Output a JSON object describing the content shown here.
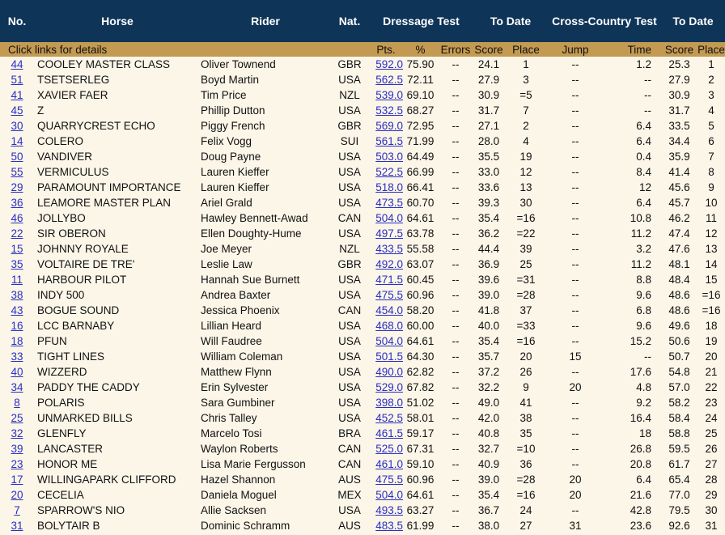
{
  "header": {
    "no": "No.",
    "horse": "Horse",
    "rider": "Rider",
    "nat": "Nat.",
    "dressage": "Dressage Test",
    "to_date_1": "To Date",
    "cross_country": "Cross-Country Test",
    "to_date_2": "To Date"
  },
  "subheader": {
    "hint": "Click links for details",
    "pts": "Pts.",
    "pct": "%",
    "errors": "Errors",
    "score": "Score",
    "place": "Place",
    "jump": "Jump",
    "time": "Time",
    "score2": "Score",
    "place2": "Place"
  },
  "rows": [
    {
      "no": "44",
      "horse": "COOLEY MASTER CLASS",
      "rider": "Oliver Townend",
      "nat": "GBR",
      "pts": "592.0",
      "pct": "75.90",
      "errors": "--",
      "score": "24.1",
      "place": "1",
      "jump": "--",
      "time": "1.2",
      "score2": "25.3",
      "place2": "1"
    },
    {
      "no": "51",
      "horse": "TSETSERLEG",
      "rider": "Boyd Martin",
      "nat": "USA",
      "pts": "562.5",
      "pct": "72.11",
      "errors": "--",
      "score": "27.9",
      "place": "3",
      "jump": "--",
      "time": "--",
      "score2": "27.9",
      "place2": "2"
    },
    {
      "no": "41",
      "horse": "XAVIER FAER",
      "rider": "Tim Price",
      "nat": "NZL",
      "pts": "539.0",
      "pct": "69.10",
      "errors": "--",
      "score": "30.9",
      "place": "=5",
      "jump": "--",
      "time": "--",
      "score2": "30.9",
      "place2": "3"
    },
    {
      "no": "45",
      "horse": "Z",
      "rider": "Phillip Dutton",
      "nat": "USA",
      "pts": "532.5",
      "pct": "68.27",
      "errors": "--",
      "score": "31.7",
      "place": "7",
      "jump": "--",
      "time": "--",
      "score2": "31.7",
      "place2": "4"
    },
    {
      "no": "30",
      "horse": "QUARRYCREST ECHO",
      "rider": "Piggy French",
      "nat": "GBR",
      "pts": "569.0",
      "pct": "72.95",
      "errors": "--",
      "score": "27.1",
      "place": "2",
      "jump": "--",
      "time": "6.4",
      "score2": "33.5",
      "place2": "5"
    },
    {
      "no": "14",
      "horse": "COLERO",
      "rider": "Felix Vogg",
      "nat": "SUI",
      "pts": "561.5",
      "pct": "71.99",
      "errors": "--",
      "score": "28.0",
      "place": "4",
      "jump": "--",
      "time": "6.4",
      "score2": "34.4",
      "place2": "6"
    },
    {
      "no": "50",
      "horse": "VANDIVER",
      "rider": "Doug Payne",
      "nat": "USA",
      "pts": "503.0",
      "pct": "64.49",
      "errors": "--",
      "score": "35.5",
      "place": "19",
      "jump": "--",
      "time": "0.4",
      "score2": "35.9",
      "place2": "7"
    },
    {
      "no": "55",
      "horse": "VERMICULUS",
      "rider": "Lauren Kieffer",
      "nat": "USA",
      "pts": "522.5",
      "pct": "66.99",
      "errors": "--",
      "score": "33.0",
      "place": "12",
      "jump": "--",
      "time": "8.4",
      "score2": "41.4",
      "place2": "8"
    },
    {
      "no": "29",
      "horse": "PARAMOUNT IMPORTANCE",
      "rider": "Lauren Kieffer",
      "nat": "USA",
      "pts": "518.0",
      "pct": "66.41",
      "errors": "--",
      "score": "33.6",
      "place": "13",
      "jump": "--",
      "time": "12",
      "score2": "45.6",
      "place2": "9"
    },
    {
      "no": "36",
      "horse": "LEAMORE MASTER PLAN",
      "rider": "Ariel Grald",
      "nat": "USA",
      "pts": "473.5",
      "pct": "60.70",
      "errors": "--",
      "score": "39.3",
      "place": "30",
      "jump": "--",
      "time": "6.4",
      "score2": "45.7",
      "place2": "10"
    },
    {
      "no": "46",
      "horse": "JOLLYBO",
      "rider": "Hawley Bennett-Awad",
      "nat": "CAN",
      "pts": "504.0",
      "pct": "64.61",
      "errors": "--",
      "score": "35.4",
      "place": "=16",
      "jump": "--",
      "time": "10.8",
      "score2": "46.2",
      "place2": "11"
    },
    {
      "no": "22",
      "horse": "SIR OBERON",
      "rider": "Ellen Doughty-Hume",
      "nat": "USA",
      "pts": "497.5",
      "pct": "63.78",
      "errors": "--",
      "score": "36.2",
      "place": "=22",
      "jump": "--",
      "time": "11.2",
      "score2": "47.4",
      "place2": "12"
    },
    {
      "no": "15",
      "horse": "JOHNNY ROYALE",
      "rider": "Joe Meyer",
      "nat": "NZL",
      "pts": "433.5",
      "pct": "55.58",
      "errors": "--",
      "score": "44.4",
      "place": "39",
      "jump": "--",
      "time": "3.2",
      "score2": "47.6",
      "place2": "13"
    },
    {
      "no": "35",
      "horse": "VOLTAIRE DE TRE'",
      "rider": "Leslie Law",
      "nat": "GBR",
      "pts": "492.0",
      "pct": "63.07",
      "errors": "--",
      "score": "36.9",
      "place": "25",
      "jump": "--",
      "time": "11.2",
      "score2": "48.1",
      "place2": "14"
    },
    {
      "no": "11",
      "horse": "HARBOUR PILOT",
      "rider": "Hannah Sue Burnett",
      "nat": "USA",
      "pts": "471.5",
      "pct": "60.45",
      "errors": "--",
      "score": "39.6",
      "place": "=31",
      "jump": "--",
      "time": "8.8",
      "score2": "48.4",
      "place2": "15"
    },
    {
      "no": "38",
      "horse": "INDY 500",
      "rider": "Andrea Baxter",
      "nat": "USA",
      "pts": "475.5",
      "pct": "60.96",
      "errors": "--",
      "score": "39.0",
      "place": "=28",
      "jump": "--",
      "time": "9.6",
      "score2": "48.6",
      "place2": "=16"
    },
    {
      "no": "43",
      "horse": "BOGUE SOUND",
      "rider": "Jessica Phoenix",
      "nat": "CAN",
      "pts": "454.0",
      "pct": "58.20",
      "errors": "--",
      "score": "41.8",
      "place": "37",
      "jump": "--",
      "time": "6.8",
      "score2": "48.6",
      "place2": "=16"
    },
    {
      "no": "16",
      "horse": "LCC BARNABY",
      "rider": "Lillian Heard",
      "nat": "USA",
      "pts": "468.0",
      "pct": "60.00",
      "errors": "--",
      "score": "40.0",
      "place": "=33",
      "jump": "--",
      "time": "9.6",
      "score2": "49.6",
      "place2": "18"
    },
    {
      "no": "18",
      "horse": "PFUN",
      "rider": "Will Faudree",
      "nat": "USA",
      "pts": "504.0",
      "pct": "64.61",
      "errors": "--",
      "score": "35.4",
      "place": "=16",
      "jump": "--",
      "time": "15.2",
      "score2": "50.6",
      "place2": "19"
    },
    {
      "no": "33",
      "horse": "TIGHT LINES",
      "rider": "William Coleman",
      "nat": "USA",
      "pts": "501.5",
      "pct": "64.30",
      "errors": "--",
      "score": "35.7",
      "place": "20",
      "jump": "15",
      "time": "--",
      "score2": "50.7",
      "place2": "20"
    },
    {
      "no": "40",
      "horse": "WIZZERD",
      "rider": "Matthew Flynn",
      "nat": "USA",
      "pts": "490.0",
      "pct": "62.82",
      "errors": "--",
      "score": "37.2",
      "place": "26",
      "jump": "--",
      "time": "17.6",
      "score2": "54.8",
      "place2": "21"
    },
    {
      "no": "34",
      "horse": "PADDY THE CADDY",
      "rider": "Erin Sylvester",
      "nat": "USA",
      "pts": "529.0",
      "pct": "67.82",
      "errors": "--",
      "score": "32.2",
      "place": "9",
      "jump": "20",
      "time": "4.8",
      "score2": "57.0",
      "place2": "22"
    },
    {
      "no": "8",
      "horse": "POLARIS",
      "rider": "Sara Gumbiner",
      "nat": "USA",
      "pts": "398.0",
      "pct": "51.02",
      "errors": "--",
      "score": "49.0",
      "place": "41",
      "jump": "--",
      "time": "9.2",
      "score2": "58.2",
      "place2": "23"
    },
    {
      "no": "25",
      "horse": "UNMARKED BILLS",
      "rider": "Chris Talley",
      "nat": "USA",
      "pts": "452.5",
      "pct": "58.01",
      "errors": "--",
      "score": "42.0",
      "place": "38",
      "jump": "--",
      "time": "16.4",
      "score2": "58.4",
      "place2": "24"
    },
    {
      "no": "32",
      "horse": "GLENFLY",
      "rider": "Marcelo Tosi",
      "nat": "BRA",
      "pts": "461.5",
      "pct": "59.17",
      "errors": "--",
      "score": "40.8",
      "place": "35",
      "jump": "--",
      "time": "18",
      "score2": "58.8",
      "place2": "25"
    },
    {
      "no": "39",
      "horse": "LANCASTER",
      "rider": "Waylon Roberts",
      "nat": "CAN",
      "pts": "525.0",
      "pct": "67.31",
      "errors": "--",
      "score": "32.7",
      "place": "=10",
      "jump": "--",
      "time": "26.8",
      "score2": "59.5",
      "place2": "26"
    },
    {
      "no": "23",
      "horse": "HONOR ME",
      "rider": "Lisa Marie Fergusson",
      "nat": "CAN",
      "pts": "461.0",
      "pct": "59.10",
      "errors": "--",
      "score": "40.9",
      "place": "36",
      "jump": "--",
      "time": "20.8",
      "score2": "61.7",
      "place2": "27"
    },
    {
      "no": "17",
      "horse": "WILLINGAPARK CLIFFORD",
      "rider": "Hazel Shannon",
      "nat": "AUS",
      "pts": "475.5",
      "pct": "60.96",
      "errors": "--",
      "score": "39.0",
      "place": "=28",
      "jump": "20",
      "time": "6.4",
      "score2": "65.4",
      "place2": "28"
    },
    {
      "no": "20",
      "horse": "CECELIA",
      "rider": "Daniela Moguel",
      "nat": "MEX",
      "pts": "504.0",
      "pct": "64.61",
      "errors": "--",
      "score": "35.4",
      "place": "=16",
      "jump": "20",
      "time": "21.6",
      "score2": "77.0",
      "place2": "29"
    },
    {
      "no": "7",
      "horse": "SPARROW'S NIO",
      "rider": "Allie Sacksen",
      "nat": "USA",
      "pts": "493.5",
      "pct": "63.27",
      "errors": "--",
      "score": "36.7",
      "place": "24",
      "jump": "--",
      "time": "42.8",
      "score2": "79.5",
      "place2": "30"
    },
    {
      "no": "31",
      "horse": "BOLYTAIR B",
      "rider": "Dominic Schramm",
      "nat": "AUS",
      "pts": "483.5",
      "pct": "61.99",
      "errors": "--",
      "score": "38.0",
      "place": "27",
      "jump": "31",
      "time": "23.6",
      "score2": "92.6",
      "place2": "31"
    }
  ]
}
